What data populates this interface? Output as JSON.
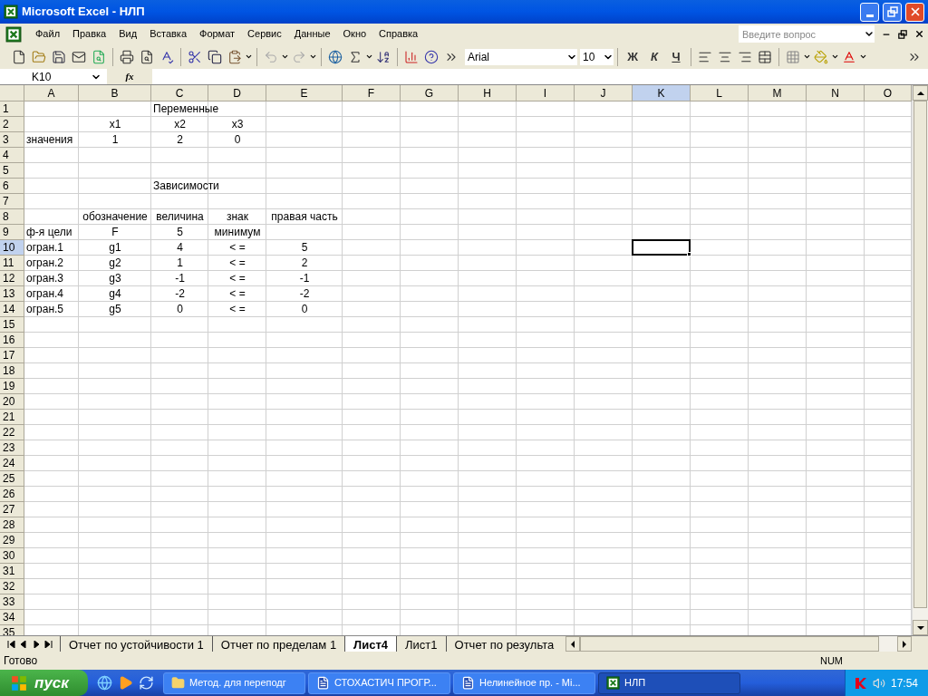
{
  "window": {
    "title": "Microsoft Excel - НЛП"
  },
  "menu": [
    {
      "label": "Файл"
    },
    {
      "label": "Правка"
    },
    {
      "label": "Вид"
    },
    {
      "label": "Вставка"
    },
    {
      "label": "Формат"
    },
    {
      "label": "Сервис"
    },
    {
      "label": "Данные"
    },
    {
      "label": "Окно"
    },
    {
      "label": "Справка"
    }
  ],
  "help_box": {
    "placeholder": "Введите вопрос"
  },
  "format_toolbar": {
    "font": "Arial",
    "size": "10",
    "bold": "Ж",
    "italic": "К",
    "underline": "Ч"
  },
  "name_box": "K10",
  "formula_bar": {
    "function_label": "fx"
  },
  "sheet": {
    "columns": [
      {
        "label": "A",
        "selected": false
      },
      {
        "label": "B",
        "selected": false
      },
      {
        "label": "C",
        "selected": false
      },
      {
        "label": "D",
        "selected": false
      },
      {
        "label": "E",
        "selected": false
      },
      {
        "label": "F",
        "selected": false
      },
      {
        "label": "G",
        "selected": false
      },
      {
        "label": "H",
        "selected": false
      },
      {
        "label": "I",
        "selected": false
      },
      {
        "label": "J",
        "selected": false
      },
      {
        "label": "K",
        "selected": true
      },
      {
        "label": "L",
        "selected": false
      },
      {
        "label": "M",
        "selected": false
      },
      {
        "label": "N",
        "selected": false
      },
      {
        "label": "O",
        "selected": false
      }
    ],
    "rows": [
      {
        "label": "1",
        "selected": false,
        "cells": {
          "C": {
            "text": "Переменные",
            "centered": false
          }
        }
      },
      {
        "label": "2",
        "selected": false,
        "cells": {
          "B": {
            "text": "x1",
            "centered": true
          },
          "C": {
            "text": "x2",
            "centered": true
          },
          "D": {
            "text": "x3",
            "centered": true
          }
        }
      },
      {
        "label": "3",
        "selected": false,
        "cells": {
          "A": {
            "text": "значения",
            "centered": false
          },
          "B": {
            "text": "1",
            "centered": true
          },
          "C": {
            "text": "2",
            "centered": true
          },
          "D": {
            "text": "0",
            "centered": true
          }
        }
      },
      {
        "label": "4",
        "selected": false
      },
      {
        "label": "5",
        "selected": false
      },
      {
        "label": "6",
        "selected": false,
        "cells": {
          "C": {
            "text": "Зависимости",
            "centered": false
          }
        }
      },
      {
        "label": "7",
        "selected": false
      },
      {
        "label": "8",
        "selected": false,
        "cells": {
          "B": {
            "text": "обозначение",
            "centered": true
          },
          "C": {
            "text": "величина",
            "centered": true
          },
          "D": {
            "text": "знак",
            "centered": true
          },
          "E": {
            "text": "правая часть",
            "centered": true
          }
        }
      },
      {
        "label": "9",
        "selected": false,
        "cells": {
          "A": {
            "text": "ф-я цели",
            "centered": false
          },
          "B": {
            "text": "F",
            "centered": true
          },
          "C": {
            "text": "5",
            "centered": true
          },
          "D": {
            "text": "минимум",
            "centered": true
          }
        }
      },
      {
        "label": "10",
        "selected": true,
        "cells": {
          "A": {
            "text": "огран.1",
            "centered": false
          },
          "B": {
            "text": "g1",
            "centered": true
          },
          "C": {
            "text": "4",
            "centered": true
          },
          "D": {
            "text": "< =",
            "centered": true
          },
          "E": {
            "text": "5",
            "centered": true
          }
        }
      },
      {
        "label": "11",
        "selected": false,
        "cells": {
          "A": {
            "text": "огран.2",
            "centered": false
          },
          "B": {
            "text": "g2",
            "centered": true
          },
          "C": {
            "text": "1",
            "centered": true
          },
          "D": {
            "text": "< =",
            "centered": true
          },
          "E": {
            "text": "2",
            "centered": true
          }
        }
      },
      {
        "label": "12",
        "selected": false,
        "cells": {
          "A": {
            "text": "огран.3",
            "centered": false
          },
          "B": {
            "text": "g3",
            "centered": true
          },
          "C": {
            "text": "-1",
            "centered": true
          },
          "D": {
            "text": "< =",
            "centered": true
          },
          "E": {
            "text": "-1",
            "centered": true
          }
        }
      },
      {
        "label": "13",
        "selected": false,
        "cells": {
          "A": {
            "text": "огран.4",
            "centered": false
          },
          "B": {
            "text": "g4",
            "centered": true
          },
          "C": {
            "text": "-2",
            "centered": true
          },
          "D": {
            "text": "< =",
            "centered": true
          },
          "E": {
            "text": "-2",
            "centered": true
          }
        }
      },
      {
        "label": "14",
        "selected": false,
        "cells": {
          "A": {
            "text": "огран.5",
            "centered": false
          },
          "B": {
            "text": "g5",
            "centered": true
          },
          "C": {
            "text": "0",
            "centered": true
          },
          "D": {
            "text": "< =",
            "centered": true
          },
          "E": {
            "text": "0",
            "centered": true
          }
        }
      },
      {
        "label": "15",
        "selected": false
      },
      {
        "label": "16",
        "selected": false
      },
      {
        "label": "17",
        "selected": false
      },
      {
        "label": "18",
        "selected": false
      },
      {
        "label": "19",
        "selected": false
      },
      {
        "label": "20",
        "selected": false
      },
      {
        "label": "21",
        "selected": false
      },
      {
        "label": "22",
        "selected": false
      },
      {
        "label": "23",
        "selected": false
      },
      {
        "label": "24",
        "selected": false
      },
      {
        "label": "25",
        "selected": false
      },
      {
        "label": "26",
        "selected": false
      },
      {
        "label": "27",
        "selected": false
      },
      {
        "label": "28",
        "selected": false
      },
      {
        "label": "29",
        "selected": false
      },
      {
        "label": "30",
        "selected": false
      },
      {
        "label": "31",
        "selected": false
      },
      {
        "label": "32",
        "selected": false
      },
      {
        "label": "33",
        "selected": false
      },
      {
        "label": "34",
        "selected": false
      },
      {
        "label": "35",
        "selected": false
      }
    ]
  },
  "sheet_tabs": [
    {
      "label": "Отчет по устойчивости 1",
      "selected": false
    },
    {
      "label": "Отчет по пределам 1",
      "selected": false
    },
    {
      "label": "Лист4",
      "selected": true
    },
    {
      "label": "Лист1",
      "selected": false
    },
    {
      "label": "Отчет по результа",
      "selected": false
    }
  ],
  "status_bar": {
    "text": "Готово",
    "indicator": "NUM"
  },
  "taskbar": {
    "start": "пуск",
    "tasks": [
      {
        "label": "Метод. для переподг",
        "kind": "folder",
        "selected": false
      },
      {
        "label": "СТОХАСТИЧ  ПРОГР...",
        "kind": "word",
        "selected": false
      },
      {
        "label": "Нелинейное пр. - Mi...",
        "kind": "word",
        "selected": false
      },
      {
        "label": "НЛП",
        "kind": "excel",
        "selected": true
      }
    ],
    "clock": "17:54"
  }
}
